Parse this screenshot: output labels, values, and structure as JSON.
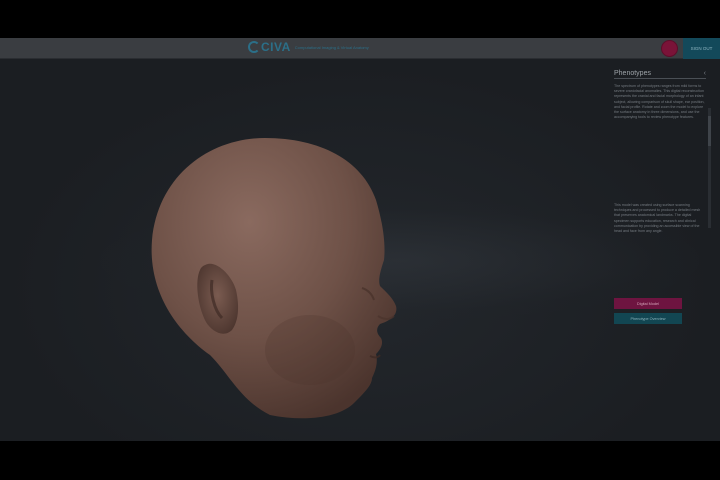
{
  "header": {
    "logo_text": "CIVA",
    "logo_subtitle": "Computational Imaging & Virtual Anatomy",
    "action_label": "SIGN OUT"
  },
  "panel": {
    "title": "Phenotypes",
    "paragraph_1": "The spectrum of phenotypes ranges from mild forms to severe craniofacial anomalies. This digital reconstruction represents the cranial and facial morphology of an infant subject, allowing comparison of skull shape, ear position, and facial profile. Rotate and zoom the model to explore the surface anatomy in three dimensions, and use the accompanying tools to review phenotype features.",
    "paragraph_2": "This model was created using surface scanning techniques and processed to produce a detailed mesh that preserves anatomical landmarks. The digital specimen supports education, research and clinical communication by providing an accessible view of the head and face from any angle.",
    "button_primary": "Digital Model",
    "button_secondary": "Phenotype Overview"
  },
  "colors": {
    "accent": "#2b6f88",
    "button_primary": "#6e1440",
    "button_secondary": "#124652",
    "skin": "#6e5147"
  }
}
